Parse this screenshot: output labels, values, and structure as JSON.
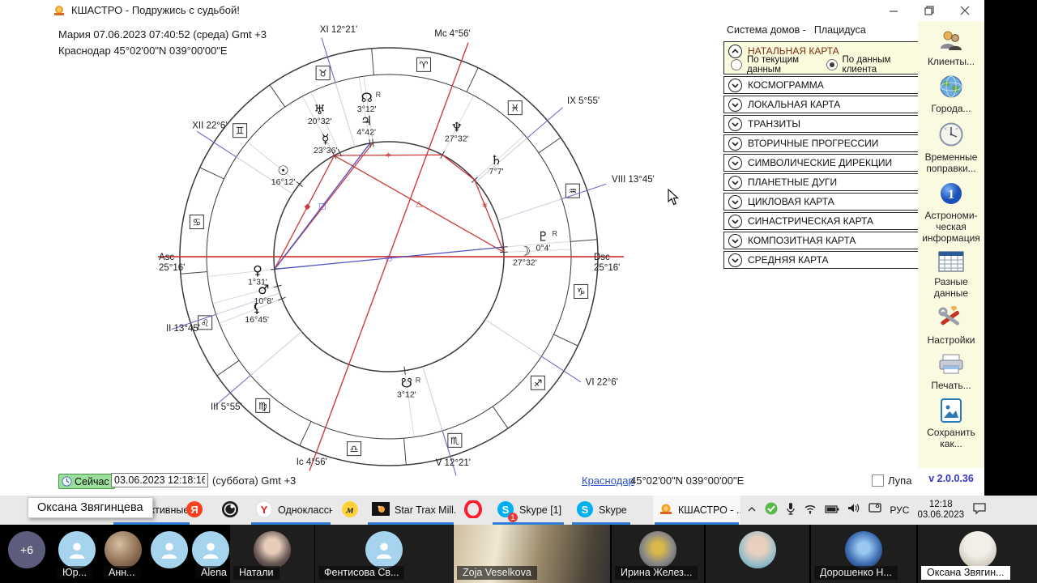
{
  "window": {
    "title": "КШАСТРО - Подружись с судьбой!"
  },
  "chart_header": {
    "person_line": "Мария 07.06.2023 07:40:52 (среда) Gmt +3",
    "place_line": "Краснодар 45°02'00\"N 039°00'00\"E"
  },
  "natal_chart": {
    "type": "natal-wheel",
    "house_system": "Плацидуса",
    "ascendant_lon": 115.267,
    "colors": {
      "axis": "#d23b3b",
      "cusp": "#6a6ac8",
      "cusp_inner": "#c9cede",
      "pointer": "#d8d8d8",
      "aspect_red": "#cc3a3a",
      "aspect_blue": "#5050c4",
      "ring": "#3a3a3a"
    },
    "signs": [
      {
        "name": "aries",
        "glyph": "♈"
      },
      {
        "name": "taurus",
        "glyph": "♉"
      },
      {
        "name": "gemini",
        "glyph": "♊"
      },
      {
        "name": "cancer",
        "glyph": "♋"
      },
      {
        "name": "leo",
        "glyph": "♌"
      },
      {
        "name": "virgo",
        "glyph": "♍"
      },
      {
        "name": "libra",
        "glyph": "♎"
      },
      {
        "name": "scorpio",
        "glyph": "♏"
      },
      {
        "name": "sagittarius",
        "glyph": "♐"
      },
      {
        "name": "capricorn",
        "glyph": "♑"
      },
      {
        "name": "aquarius",
        "glyph": "♒"
      },
      {
        "name": "pisces",
        "glyph": "♓"
      }
    ],
    "houses": [
      {
        "id": "asc",
        "label": "Asc",
        "deg": "25°16'",
        "lon": 115.267,
        "axis": true
      },
      {
        "id": "h2",
        "label": "II",
        "deg": "13°45'",
        "lon": 133.75
      },
      {
        "id": "h3",
        "label": "III",
        "deg": "5°55'",
        "lon": 155.917
      },
      {
        "id": "ic",
        "label": "Ic",
        "deg": "4°56'",
        "lon": 184.933,
        "axis": true
      },
      {
        "id": "h5",
        "label": "V",
        "deg": "12°21'",
        "lon": 222.35
      },
      {
        "id": "h6",
        "label": "VI",
        "deg": "22°6'",
        "lon": 262.1
      },
      {
        "id": "dsc",
        "label": "Dsc",
        "deg": "25°16'",
        "lon": 295.267,
        "axis": true
      },
      {
        "id": "h8",
        "label": "VIII",
        "deg": "13°45'",
        "lon": 313.75
      },
      {
        "id": "h9",
        "label": "IX",
        "deg": "5°55'",
        "lon": 335.917
      },
      {
        "id": "mc",
        "label": "Mc",
        "deg": "4°56'",
        "lon": 4.933,
        "axis": true
      },
      {
        "id": "h11",
        "label": "XI",
        "deg": "12°21'",
        "lon": 42.35
      },
      {
        "id": "h12",
        "label": "XII",
        "deg": "22°6'",
        "lon": 82.1
      }
    ],
    "planets": [
      {
        "id": "sun",
        "glyph": "☉",
        "deg": "16°12'",
        "lon": 76.2,
        "r": 168
      },
      {
        "id": "moon",
        "glyph": "☽",
        "deg": "27°32'",
        "lon": 297.533,
        "r": 168
      },
      {
        "id": "mercury",
        "glyph": "☿",
        "deg": "23°36'",
        "lon": 53.6,
        "r": 165
      },
      {
        "id": "venus",
        "glyph": "♀",
        "deg": "1°31'",
        "lon": 121.517,
        "r": 163
      },
      {
        "id": "mars",
        "glyph": "♂",
        "deg": "10°8'",
        "lon": 130.133,
        "r": 160
      },
      {
        "id": "jupiter",
        "glyph": "♃",
        "deg": "4°42'",
        "lon": 34.7,
        "r": 170
      },
      {
        "id": "saturn",
        "glyph": "♄",
        "deg": "7°7'",
        "lon": 337.117,
        "r": 178
      },
      {
        "id": "uranus",
        "glyph": "♅",
        "deg": "20°32'",
        "lon": 50.533,
        "r": 200
      },
      {
        "id": "neptune",
        "glyph": "♆",
        "deg": "27°32'",
        "lon": 357.533,
        "r": 180
      },
      {
        "id": "pluto",
        "glyph": "♇",
        "deg": "0°4'",
        "lon": 300.067,
        "r": 192,
        "dlon": 2.5,
        "retro": true
      },
      {
        "id": "node-north",
        "glyph": "☊",
        "deg": "3°12'",
        "lon": 33.2,
        "r": 198,
        "retro": true
      },
      {
        "id": "node-south",
        "glyph": "☋",
        "deg": "3°12'",
        "lon": 213.2,
        "r": 158,
        "retro": true
      },
      {
        "id": "lilith",
        "glyph": "⚸",
        "deg": "16°45'",
        "lon": 136.75,
        "r": 175
      }
    ],
    "aspects": [
      {
        "a": "mercury",
        "b": "neptune",
        "color": "red",
        "sym": "∗"
      },
      {
        "a": "neptune",
        "b": "saturn",
        "color": "red"
      },
      {
        "a": "saturn",
        "b": "moon",
        "color": "red",
        "sym": "∗",
        "pos": 0.35
      },
      {
        "a": "mercury",
        "b": "moon",
        "color": "red",
        "sym": "△"
      },
      {
        "a": "mercury",
        "b": "venus",
        "color": "red",
        "sym": "◆",
        "pos": 0.45
      },
      {
        "a": "venus",
        "b": "node-north",
        "color": "red"
      },
      {
        "a": "venus",
        "b": "jupiter",
        "color": "blue",
        "sym": "□",
        "pos": 0.5
      },
      {
        "a": "venus",
        "b": "pluto",
        "color": "blue",
        "sym": "○"
      }
    ]
  },
  "right_panel": {
    "house_system_label": "Система домов -",
    "house_system_value": "Плацидуса",
    "natal": {
      "label": "НАТАЛЬНАЯ КАРТА",
      "radio_current": "По текущим данным",
      "radio_client": "По данным клиента",
      "selected": "client"
    },
    "items": [
      "КОСМОГРАММА",
      "ЛОКАЛЬНАЯ КАРТА",
      "ТРАНЗИТЫ",
      "ВТОРИЧНЫЕ ПРОГРЕССИИ",
      "СИМВОЛИЧЕСКИЕ ДИРЕКЦИИ",
      "ПЛАНЕТНЫЕ ДУГИ",
      "ЦИКЛОВАЯ КАРТА",
      "СИНАСТРИЧЕСКАЯ КАРТА",
      "КОМПОЗИТНАЯ КАРТА",
      "СРЕДНЯЯ КАРТА"
    ]
  },
  "side_toolbar": {
    "items": [
      {
        "icon": "clients-icon",
        "label": "Клиенты..."
      },
      {
        "icon": "cities-icon",
        "label": "Города..."
      },
      {
        "icon": "time-corrections-icon",
        "label": "Временные поправки..."
      },
      {
        "icon": "astro-info-icon",
        "label": "Астрономи-ческая информация"
      },
      {
        "icon": "misc-data-icon",
        "label": "Разные данные"
      },
      {
        "icon": "settings-icon",
        "label": "Настройки"
      },
      {
        "icon": "print-icon",
        "label": "Печать..."
      },
      {
        "icon": "save-as-icon",
        "label": "Сохранить как..."
      }
    ],
    "version": "v 2.0.0.36"
  },
  "status_bar": {
    "now_button": "Сейчас",
    "datetime_value": "03.06.2023 12:18:16",
    "weekday_tz": "(суббота) Gmt +3",
    "city_link": "Краснодар",
    "coords": "45°02'00\"N 039°00'00\"E",
    "magnifier_label": "Лупа"
  },
  "taskbar": {
    "items": [
      {
        "id": "fiktivnye",
        "icon": "window-icon",
        "label": "Фиктивные ...",
        "open": true
      },
      {
        "id": "yandex",
        "icon": "yandex-icon",
        "open": false
      },
      {
        "id": "obs",
        "icon": "obs-icon",
        "open": false
      },
      {
        "id": "odnoklassniki",
        "icon": "ybrowser-icon",
        "label": "Одноклассн...",
        "open": true
      },
      {
        "id": "yellow-m",
        "icon": "yellow-m-icon",
        "open": false
      },
      {
        "id": "star-trax",
        "icon": "video-thumb-icon",
        "label": "Star Trax Mill...",
        "open": true
      },
      {
        "id": "opera",
        "icon": "opera-icon",
        "open": false
      },
      {
        "id": "skype-unread",
        "icon": "skype-icon",
        "label": "Skype [1]",
        "badge": "1",
        "open": true
      },
      {
        "id": "skype",
        "icon": "skype-icon",
        "label": "Skype",
        "open": true
      },
      {
        "id": "kshastro",
        "icon": "kshastro-icon",
        "label": "КШАСТРО - ...",
        "open": true,
        "active": true
      }
    ],
    "tray": {
      "lang": "РУС",
      "time": "12:18",
      "date": "03.06.2023"
    }
  },
  "tooltip": {
    "text": "Оксана Звягинцева"
  },
  "video_strip": {
    "tiles": [
      {
        "kind": "overflow",
        "label": "+6"
      },
      {
        "kind": "avatar-placeholder",
        "name": "Юр..."
      },
      {
        "kind": "avatar-photo",
        "photo": "photo1",
        "name": "Анн..."
      },
      {
        "kind": "avatar-placeholder"
      },
      {
        "kind": "avatar-placeholder",
        "name": "Alena"
      },
      {
        "kind": "avatar-photo",
        "photo": "photo2",
        "name": "Натали"
      },
      {
        "kind": "avatar-placeholder",
        "name": "Фентисова Св..."
      },
      {
        "kind": "video",
        "name": "Zoja Veselkova"
      },
      {
        "kind": "avatar-photo",
        "photo": "photo3",
        "name": "Ирина Желез..."
      },
      {
        "kind": "avatar-photo",
        "photo": "photo4"
      },
      {
        "kind": "avatar-photo",
        "photo": "photo5",
        "name": "Дорошенко Н..."
      },
      {
        "kind": "avatar-photo",
        "photo": "photo6",
        "name": "Оксана Звягин...",
        "name_style": "light"
      }
    ]
  }
}
